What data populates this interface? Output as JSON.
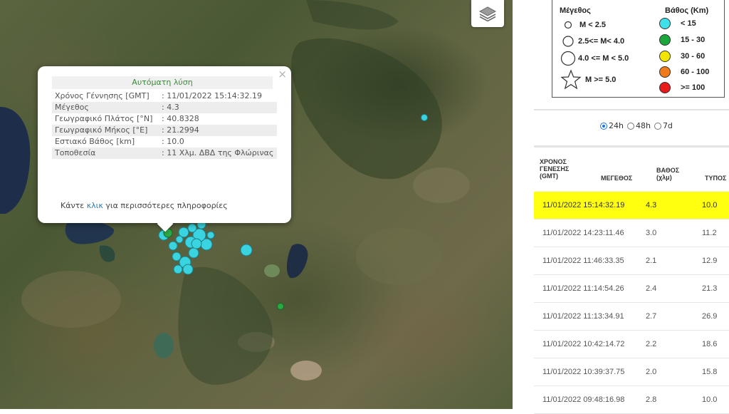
{
  "map": {
    "popup": {
      "title": "Αυτόματη λύση",
      "close_symbol": "×",
      "rows": [
        {
          "label": "Χρόνος Γέννησης [GMT]",
          "value": ": 11/01/2022 15:14:32.19"
        },
        {
          "label": "Μέγεθος",
          "value": ": 4.3"
        },
        {
          "label": "Γεωγραφικό Πλάτος [°N]",
          "value": ": 40.8328"
        },
        {
          "label": "Γεωγραφικό Μήκος [°E]",
          "value": ": 21.2994"
        },
        {
          "label": "Εστιακό Βάθος [km]",
          "value": ": 10.0"
        },
        {
          "label": "Τοποθεσία",
          "value": ": 11 Χλμ. ΔΒΔ της Φλώρινας"
        }
      ],
      "more_prefix": "Κάντε ",
      "more_link": "κλικ",
      "more_suffix": " για περισσότερες πληροφορίες"
    },
    "layers_icon": "layers-icon",
    "colors": {
      "shallow": "#3ad4e0",
      "mid": "#2aa845"
    }
  },
  "legend": {
    "magnitude_title": "Μέγεθος",
    "depth_title": "Βάθος (Km)",
    "magnitude_items": [
      "M < 2.5",
      "2.5<= M< 4.0",
      "4.0 <= M < 5.0",
      "M >= 5.0"
    ],
    "depth_items": [
      {
        "label": "< 15",
        "color": "#40e0e8"
      },
      {
        "label": "15 - 30",
        "color": "#1aa83c"
      },
      {
        "label": "30 - 60",
        "color": "#f2e600"
      },
      {
        "label": "60 - 100",
        "color": "#f07a1a"
      },
      {
        "label": ">= 100",
        "color": "#e81a1a"
      }
    ]
  },
  "filters": {
    "options": [
      "24h",
      "48h",
      "7d"
    ],
    "selected": "24h"
  },
  "table": {
    "headers": {
      "time_line1": "ΧΡΟΝΟΣ",
      "time_line2": "ΓΕΝΕΣΗΣ",
      "time_line3": "(GMT)",
      "magnitude": "ΜΕΓΕΘΟΣ",
      "depth_line1": "ΒΑΘΟΣ",
      "depth_line2": "(χλμ)",
      "type": "ΤΥΠΟΣ"
    },
    "rows": [
      {
        "time": "11/01/2022 15:14:32.19",
        "magnitude": "4.3",
        "depth": "10.0",
        "selected": true
      },
      {
        "time": "11/01/2022 14:23:11.46",
        "magnitude": "3.0",
        "depth": "11.2"
      },
      {
        "time": "11/01/2022 11:46:33.35",
        "magnitude": "2.1",
        "depth": "12.9"
      },
      {
        "time": "11/01/2022 11:14:54.26",
        "magnitude": "2.4",
        "depth": "21.3"
      },
      {
        "time": "11/01/2022 11:13:34.91",
        "magnitude": "2.7",
        "depth": "26.9"
      },
      {
        "time": "11/01/2022 10:42:14.72",
        "magnitude": "2.2",
        "depth": "18.6"
      },
      {
        "time": "11/01/2022 10:39:37.75",
        "magnitude": "2.0",
        "depth": "15.8"
      },
      {
        "time": "11/01/2022 09:48:16.98",
        "magnitude": "2.8",
        "depth": "10.0"
      }
    ]
  }
}
